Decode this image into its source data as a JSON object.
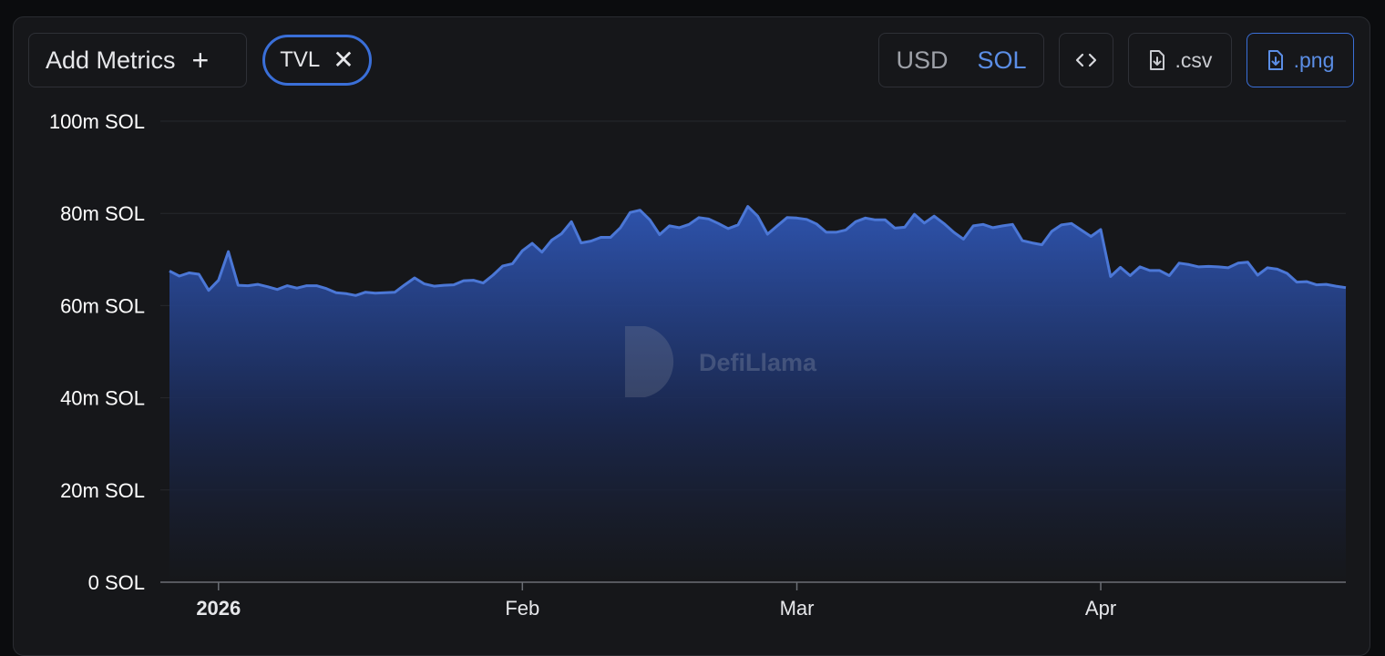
{
  "toolbar": {
    "add_metrics_label": "Add Metrics",
    "tvl_chip_label": "TVL",
    "unit_usd_label": "USD",
    "unit_sol_label": "SOL",
    "unit_selected": "SOL",
    "csv_label": ".csv",
    "png_label": ".png"
  },
  "watermark": "DefiLlama",
  "colors": {
    "accent": "#3a6fd8",
    "line": "#4b77d6",
    "selected_text": "#5b8ee6"
  },
  "chart_data": {
    "type": "area",
    "series": [
      {
        "name": "TVL",
        "unit": "SOL"
      }
    ],
    "ylim": [
      0,
      100000000
    ],
    "yticks": [
      {
        "value": 0,
        "label": "0 SOL"
      },
      {
        "value": 20000000,
        "label": "20m SOL"
      },
      {
        "value": 40000000,
        "label": "40m SOL"
      },
      {
        "value": 60000000,
        "label": "60m SOL"
      },
      {
        "value": 80000000,
        "label": "80m SOL"
      },
      {
        "value": 100000000,
        "label": "100m SOL"
      }
    ],
    "xticks": [
      {
        "date": "2026-01-01",
        "label": "2026"
      },
      {
        "date": "2026-02-01",
        "label": "Feb"
      },
      {
        "date": "2026-03-01",
        "label": "Mar"
      },
      {
        "date": "2026-04-01",
        "label": "Apr"
      }
    ],
    "xlim": [
      "2025-12-27",
      "2026-04-26"
    ],
    "grid": true,
    "legend": "none",
    "points": [
      [
        "2025-12-27",
        67.5
      ],
      [
        "2025-12-28",
        66.4
      ],
      [
        "2025-12-29",
        67.1
      ],
      [
        "2025-12-30",
        66.8
      ],
      [
        "2025-12-31",
        63.3
      ],
      [
        "2026-01-01",
        65.5
      ],
      [
        "2026-01-02",
        71.7
      ],
      [
        "2026-01-03",
        64.4
      ],
      [
        "2026-01-04",
        64.3
      ],
      [
        "2026-01-05",
        64.6
      ],
      [
        "2026-01-06",
        64.1
      ],
      [
        "2026-01-07",
        63.5
      ],
      [
        "2026-01-08",
        64.3
      ],
      [
        "2026-01-09",
        63.8
      ],
      [
        "2026-01-10",
        64.3
      ],
      [
        "2026-01-11",
        64.3
      ],
      [
        "2026-01-12",
        63.7
      ],
      [
        "2026-01-13",
        62.8
      ],
      [
        "2026-01-14",
        62.6
      ],
      [
        "2026-01-15",
        62.2
      ],
      [
        "2026-01-16",
        62.9
      ],
      [
        "2026-01-17",
        62.7
      ],
      [
        "2026-01-18",
        62.8
      ],
      [
        "2026-01-19",
        62.9
      ],
      [
        "2026-01-20",
        64.5
      ],
      [
        "2026-01-21",
        66.0
      ],
      [
        "2026-01-22",
        64.7
      ],
      [
        "2026-01-23",
        64.2
      ],
      [
        "2026-01-24",
        64.4
      ],
      [
        "2026-01-25",
        64.5
      ],
      [
        "2026-01-26",
        65.4
      ],
      [
        "2026-01-27",
        65.5
      ],
      [
        "2026-01-28",
        64.9
      ],
      [
        "2026-01-29",
        66.6
      ],
      [
        "2026-01-30",
        68.6
      ],
      [
        "2026-01-31",
        69.1
      ],
      [
        "2026-02-01",
        71.9
      ],
      [
        "2026-02-02",
        73.5
      ],
      [
        "2026-02-03",
        71.6
      ],
      [
        "2026-02-04",
        74.2
      ],
      [
        "2026-02-05",
        75.6
      ],
      [
        "2026-02-06",
        78.2
      ],
      [
        "2026-02-07",
        73.6
      ],
      [
        "2026-02-08",
        74.0
      ],
      [
        "2026-02-09",
        74.8
      ],
      [
        "2026-02-10",
        74.8
      ],
      [
        "2026-02-11",
        76.9
      ],
      [
        "2026-02-12",
        80.2
      ],
      [
        "2026-02-13",
        80.7
      ],
      [
        "2026-02-14",
        78.6
      ],
      [
        "2026-02-15",
        75.4
      ],
      [
        "2026-02-16",
        77.3
      ],
      [
        "2026-02-17",
        76.9
      ],
      [
        "2026-02-18",
        77.6
      ],
      [
        "2026-02-19",
        79.1
      ],
      [
        "2026-02-20",
        78.8
      ],
      [
        "2026-02-21",
        77.8
      ],
      [
        "2026-02-22",
        76.7
      ],
      [
        "2026-02-23",
        77.5
      ],
      [
        "2026-02-24",
        81.5
      ],
      [
        "2026-02-25",
        79.4
      ],
      [
        "2026-02-26",
        75.5
      ],
      [
        "2026-02-27",
        77.3
      ],
      [
        "2026-02-28",
        79.1
      ],
      [
        "2026-03-01",
        79.0
      ],
      [
        "2026-03-02",
        78.7
      ],
      [
        "2026-03-03",
        77.7
      ],
      [
        "2026-03-04",
        75.9
      ],
      [
        "2026-03-05",
        75.9
      ],
      [
        "2026-03-06",
        76.4
      ],
      [
        "2026-03-07",
        78.2
      ],
      [
        "2026-03-08",
        79.0
      ],
      [
        "2026-03-09",
        78.6
      ],
      [
        "2026-03-10",
        78.6
      ],
      [
        "2026-03-11",
        76.8
      ],
      [
        "2026-03-12",
        77.0
      ],
      [
        "2026-03-13",
        79.8
      ],
      [
        "2026-03-14",
        77.9
      ],
      [
        "2026-03-15",
        79.4
      ],
      [
        "2026-03-16",
        77.8
      ],
      [
        "2026-03-17",
        75.9
      ],
      [
        "2026-03-18",
        74.4
      ],
      [
        "2026-03-19",
        77.3
      ],
      [
        "2026-03-20",
        77.6
      ],
      [
        "2026-03-21",
        76.9
      ],
      [
        "2026-03-22",
        77.3
      ],
      [
        "2026-03-23",
        77.6
      ],
      [
        "2026-03-24",
        74.1
      ],
      [
        "2026-03-25",
        73.6
      ],
      [
        "2026-03-26",
        73.2
      ],
      [
        "2026-03-27",
        76.1
      ],
      [
        "2026-03-28",
        77.5
      ],
      [
        "2026-03-29",
        77.8
      ],
      [
        "2026-03-30",
        76.4
      ],
      [
        "2026-03-31",
        75.0
      ],
      [
        "2026-04-01",
        76.5
      ],
      [
        "2026-04-02",
        66.3
      ],
      [
        "2026-04-03",
        68.3
      ],
      [
        "2026-04-04",
        66.5
      ],
      [
        "2026-04-05",
        68.4
      ],
      [
        "2026-04-06",
        67.6
      ],
      [
        "2026-04-07",
        67.6
      ],
      [
        "2026-04-08",
        66.5
      ],
      [
        "2026-04-09",
        69.2
      ],
      [
        "2026-04-10",
        68.9
      ],
      [
        "2026-04-11",
        68.4
      ],
      [
        "2026-04-12",
        68.5
      ],
      [
        "2026-04-13",
        68.4
      ],
      [
        "2026-04-14",
        68.2
      ],
      [
        "2026-04-15",
        69.2
      ],
      [
        "2026-04-16",
        69.4
      ],
      [
        "2026-04-17",
        66.6
      ],
      [
        "2026-04-18",
        68.2
      ],
      [
        "2026-04-19",
        67.9
      ],
      [
        "2026-04-20",
        67.0
      ],
      [
        "2026-04-21",
        65.1
      ],
      [
        "2026-04-22",
        65.2
      ],
      [
        "2026-04-23",
        64.5
      ],
      [
        "2026-04-24",
        64.6
      ],
      [
        "2026-04-25",
        64.2
      ],
      [
        "2026-04-26",
        63.9
      ]
    ],
    "points_unit": "m SOL"
  }
}
